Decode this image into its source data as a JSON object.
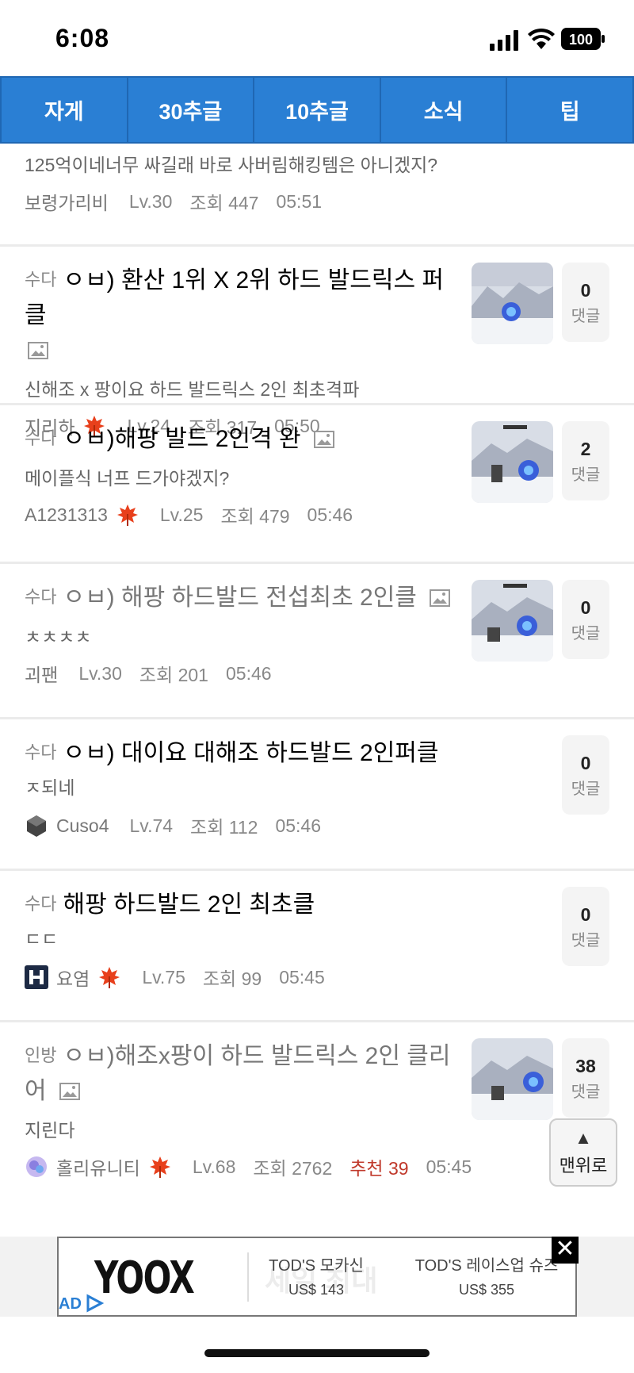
{
  "status": {
    "time": "6:08",
    "battery": "100"
  },
  "tabs": [
    "자게",
    "30추글",
    "10추글",
    "소식",
    "팁"
  ],
  "partial_post": {
    "preview": "125억이네너무 싸길래 바로 사버림해킹템은 아니겠지?",
    "author": "보령가리비",
    "level": "Lv.30",
    "views": "조회 447",
    "time": "05:51"
  },
  "posts": [
    {
      "category": "수다",
      "title": "ㅇㅂ) 환산 1위 X 2위 하드 발드릭스 퍼클",
      "preview": "신해조 x 팡이요 하드 발드릭스 2인 최초격파",
      "author": "지리하",
      "level": "Lv.24",
      "views": "조회 317",
      "time": "05:50",
      "comments": "0",
      "comments_label": "댓글"
    },
    {
      "category": "수다",
      "title": "ㅇㅂ)해팡 발드 2인격 완",
      "preview": "메이플식 너프 드가야겠지?",
      "author": "A1231313",
      "level": "Lv.25",
      "views": "조회 479",
      "time": "05:46",
      "comments": "2",
      "comments_label": "댓글"
    },
    {
      "category": "수다",
      "title": "ㅇㅂ) 해팡 하드발드 전섭최초 2인클",
      "preview": "ㅊㅊㅊㅊ",
      "author": "괴팬",
      "level": "Lv.30",
      "views": "조회 201",
      "time": "05:46",
      "comments": "0",
      "comments_label": "댓글"
    },
    {
      "category": "수다",
      "title": "ㅇㅂ) 대이요 대해조 하드발드 2인퍼클",
      "preview": "ㅈ되네",
      "author": "Cuso4",
      "level": "Lv.74",
      "views": "조회 112",
      "time": "05:46",
      "comments": "0",
      "comments_label": "댓글"
    },
    {
      "category": "수다",
      "title": "해팡 하드발드 2인 최초클",
      "preview": "ㄷㄷ",
      "author": "요염",
      "level": "Lv.75",
      "views": "조회 99",
      "time": "05:45",
      "comments": "0",
      "comments_label": "댓글"
    },
    {
      "category": "인방",
      "title": "ㅇㅂ)해조x팡이 하드 발드릭스 2인 클리어",
      "preview": "지린다",
      "author": "홀리유니티",
      "level": "Lv.68",
      "views": "조회 2762",
      "recommend": "추천 39",
      "time": "05:45",
      "comments": "38",
      "comments_label": "댓글"
    }
  ],
  "top_button": {
    "arrow": "▲",
    "label": "맨위로"
  },
  "ad": {
    "brand": "YOOX",
    "ghost": "세일 최대",
    "products": [
      {
        "name": "TOD'S 모카신",
        "price": "US$ 143"
      },
      {
        "name": "TOD'S 레이스업 슈즈",
        "price": "US$ 355"
      }
    ],
    "label": "AD",
    "close": "✕"
  }
}
